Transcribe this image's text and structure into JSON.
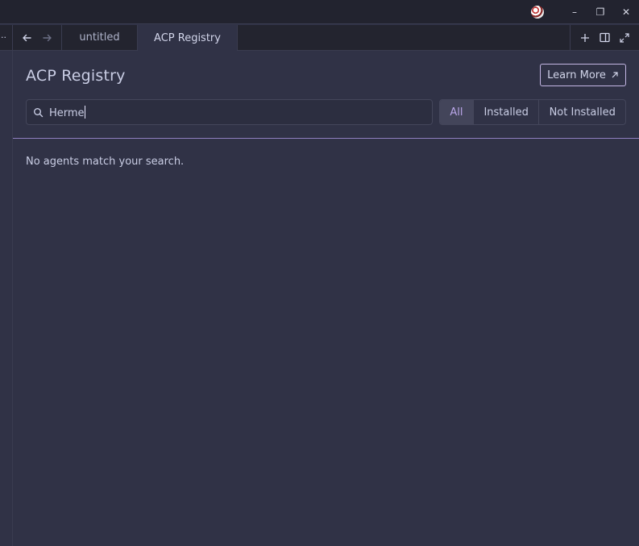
{
  "titlebar": {
    "controls": {
      "avatar_icon": "user-avatar-icon",
      "minimize": "–",
      "restore": "❐",
      "close": "✕"
    }
  },
  "tabbar": {
    "left_stub_glyph": "··",
    "tabs": [
      {
        "label": "untitled",
        "active": false
      },
      {
        "label": "ACP Registry",
        "active": true
      }
    ],
    "actions": {
      "new_tab_icon": "plus-icon",
      "split_icon": "split-pane-icon",
      "expand_icon": "expand-icon"
    }
  },
  "page": {
    "title": "ACP Registry",
    "learn_more_label": "Learn More",
    "search": {
      "value": "Herme",
      "icon": "search-icon"
    },
    "filters": [
      {
        "label": "All",
        "selected": true
      },
      {
        "label": "Installed",
        "selected": false
      },
      {
        "label": "Not Installed",
        "selected": false
      }
    ],
    "empty_message": "No agents match your search."
  },
  "colors": {
    "background": "#303246",
    "titlebar": "#22232f",
    "accent": "#b9a6e8",
    "divider": "#8f7fbf"
  }
}
